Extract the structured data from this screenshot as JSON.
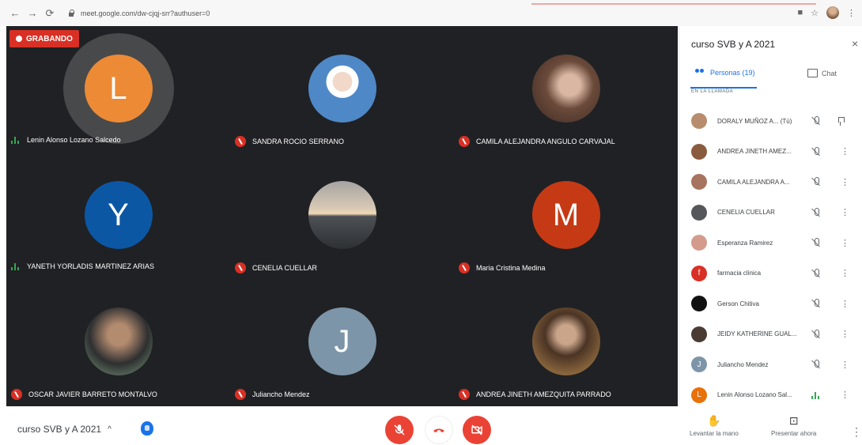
{
  "browser": {
    "url": "meet.google.com/dw-cjqj-srr?authuser=0"
  },
  "stage": {
    "recording_label": "GRABANDO"
  },
  "tiles": [
    {
      "name": "Lenin Alonso Lozano Salcedo",
      "initial": "L",
      "color": "#e8710a",
      "status": "talking",
      "photo": ""
    },
    {
      "name": "SANDRA ROCIO SERRANO",
      "initial": "",
      "color": "",
      "status": "muted",
      "photo": "photo-sandra"
    },
    {
      "name": "CAMILA ALEJANDRA ANGULO CARVAJAL",
      "initial": "",
      "color": "",
      "status": "muted",
      "photo": "photo-camila"
    },
    {
      "name": "YANETH YORLADIS MARTINEZ ARIAS",
      "initial": "Y",
      "color": "#0b57a4",
      "status": "talking",
      "photo": ""
    },
    {
      "name": "CENELIA CUELLAR",
      "initial": "",
      "color": "",
      "status": "muted",
      "photo": "photo-cenelia"
    },
    {
      "name": "Maria Cristina Medina",
      "initial": "M",
      "color": "#c53a15",
      "status": "muted",
      "photo": ""
    },
    {
      "name": "OSCAR JAVIER BARRETO MONTALVO",
      "initial": "",
      "color": "",
      "status": "muted",
      "photo": "photo-oscar"
    },
    {
      "name": "Juliancho Mendez",
      "initial": "J",
      "color": "#7d95a8",
      "status": "muted",
      "photo": ""
    },
    {
      "name": "ANDREA JINETH AMEZQUITA PARRADO",
      "initial": "",
      "color": "",
      "status": "muted",
      "photo": "photo-andrea"
    }
  ],
  "bottom": {
    "meeting_title": "curso SVB y A 2021",
    "chevron": "^",
    "raise_hand_label": "Levantar la mano",
    "present_label": "Presentar ahora"
  },
  "panel": {
    "title": "curso SVB y A 2021",
    "close": "×",
    "tab_people": "Personas (19)",
    "tab_chat": "Chat",
    "section_label": "EN LA LLAMADA",
    "people": [
      {
        "name": "DORALY MUÑOZ A...  (Tú)",
        "initial": "",
        "color": "#b78d6e",
        "status": "muted",
        "action": "pin"
      },
      {
        "name": "ANDREA JINETH AMEZ...",
        "initial": "",
        "color": "#8a5c3f",
        "status": "muted",
        "action": "more"
      },
      {
        "name": "CAMILA ALEJANDRA A...",
        "initial": "",
        "color": "#a77460",
        "status": "muted",
        "action": "more"
      },
      {
        "name": "CENELIA CUELLAR",
        "initial": "",
        "color": "#56575a",
        "status": "muted",
        "action": "more"
      },
      {
        "name": "Esperanza Ramirez",
        "initial": "",
        "color": "#d49a8c",
        "status": "muted",
        "action": "more"
      },
      {
        "name": "farmacia clinica",
        "initial": "f",
        "color": "#d93025",
        "status": "muted",
        "action": "more"
      },
      {
        "name": "Gerson Chitiva",
        "initial": "",
        "color": "#111111",
        "status": "muted",
        "action": "more"
      },
      {
        "name": "JEIDY KATHERINE GUAL...",
        "initial": "",
        "color": "#4a3b33",
        "status": "muted",
        "action": "more"
      },
      {
        "name": "Juliancho Mendez",
        "initial": "J",
        "color": "#7d95a8",
        "status": "muted",
        "action": "more"
      },
      {
        "name": "Lenin Alonso Lozano Sal...",
        "initial": "L",
        "color": "#e8710a",
        "status": "talking",
        "action": "more"
      }
    ]
  }
}
